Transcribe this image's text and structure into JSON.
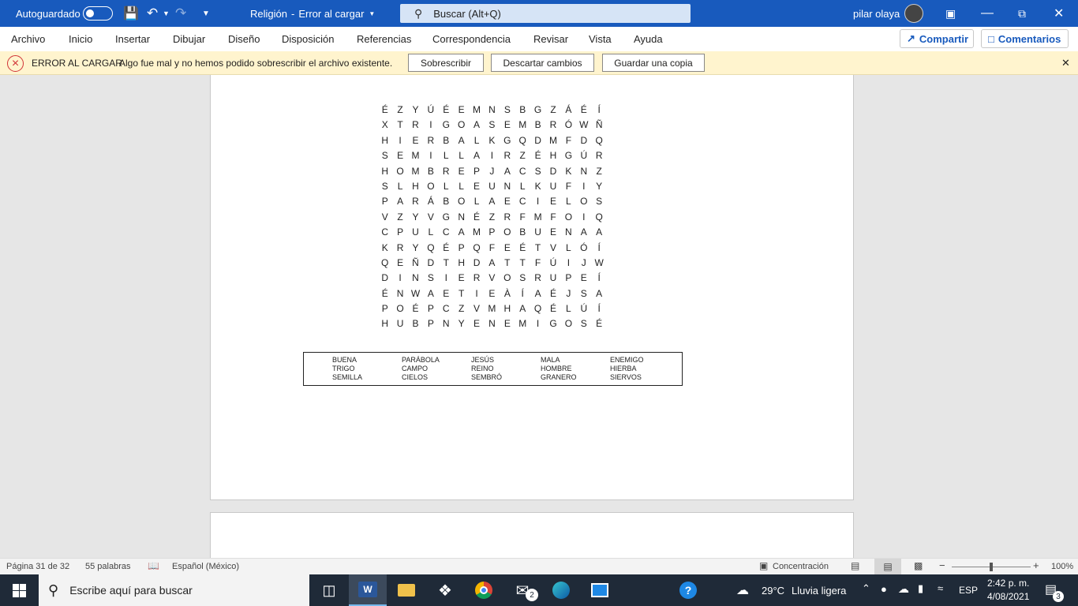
{
  "titlebar": {
    "autosave_label": "Autoguardado",
    "doc_title": "Religión",
    "separator": "-",
    "status": "Error al cargar",
    "search_label": "Buscar (Alt+Q)",
    "user_name": "pilar olaya"
  },
  "menu": {
    "items": [
      "Archivo",
      "Inicio",
      "Insertar",
      "Dibujar",
      "Diseño",
      "Disposición",
      "Referencias",
      "Correspondencia",
      "Revisar",
      "Vista",
      "Ayuda"
    ],
    "share_label": "Compartir",
    "comments_label": "Comentarios"
  },
  "error_bar": {
    "title": "ERROR AL CARGAR",
    "message": "Algo fue mal y no hemos podido sobrescribir el archivo existente.",
    "overwrite_label": "Sobrescribir",
    "discard_label": "Descartar cambios",
    "save_copy_label": "Guardar una copia",
    "close_glyph": "✕"
  },
  "puzzle": {
    "rows": [
      [
        "É",
        "Z",
        "Y",
        "Ú",
        "É",
        "E",
        "M",
        "N",
        "S",
        "B",
        "G",
        "Z",
        "Á",
        "É",
        "Í"
      ],
      [
        "X",
        "T",
        "R",
        "I",
        "G",
        "O",
        "A",
        "S",
        "E",
        "M",
        "B",
        "R",
        "Ó",
        "W",
        "Ñ"
      ],
      [
        "H",
        "I",
        "E",
        "R",
        "B",
        "A",
        "L",
        "K",
        "G",
        "Q",
        "D",
        "M",
        "F",
        "D",
        "Q"
      ],
      [
        "S",
        "E",
        "M",
        "I",
        "L",
        "L",
        "A",
        "I",
        "R",
        "Z",
        "É",
        "H",
        "G",
        "Ú",
        "R"
      ],
      [
        "H",
        "O",
        "M",
        "B",
        "R",
        "E",
        "P",
        "J",
        "A",
        "C",
        "S",
        "D",
        "K",
        "N",
        "Z"
      ],
      [
        "S",
        "L",
        "H",
        "O",
        "L",
        "L",
        "E",
        "U",
        "N",
        "L",
        "K",
        "U",
        "F",
        "I",
        "Y"
      ],
      [
        "P",
        "A",
        "R",
        "Á",
        "B",
        "O",
        "L",
        "A",
        "E",
        "C",
        "I",
        "E",
        "L",
        "O",
        "S"
      ],
      [
        "V",
        "Z",
        "Y",
        "V",
        "G",
        "N",
        "É",
        "Z",
        "R",
        "F",
        "M",
        "F",
        "O",
        "I",
        "Q"
      ],
      [
        "C",
        "P",
        "U",
        "L",
        "C",
        "A",
        "M",
        "P",
        "O",
        "B",
        "U",
        "E",
        "N",
        "A",
        "A"
      ],
      [
        "K",
        "R",
        "Y",
        "Q",
        "É",
        "P",
        "Q",
        "F",
        "E",
        "É",
        "T",
        "V",
        "L",
        "Ó",
        "Í"
      ],
      [
        "Q",
        "E",
        "Ñ",
        "D",
        "T",
        "H",
        "D",
        "A",
        "T",
        "T",
        "F",
        "Ú",
        "I",
        "J",
        "W"
      ],
      [
        "D",
        "I",
        "N",
        "S",
        "I",
        "E",
        "R",
        "V",
        "O",
        "S",
        "R",
        "U",
        "P",
        "E",
        "Í"
      ],
      [
        "É",
        "N",
        "W",
        "A",
        "E",
        "T",
        "I",
        "E",
        "À",
        "Í",
        "A",
        "É",
        "J",
        "S",
        "A"
      ],
      [
        "P",
        "O",
        "É",
        "P",
        "C",
        "Z",
        "V",
        "M",
        "H",
        "A",
        "Q",
        "É",
        "L",
        "Ú",
        "Í"
      ],
      [
        "H",
        "U",
        "B",
        "P",
        "N",
        "Y",
        "E",
        "N",
        "E",
        "M",
        "I",
        "G",
        "O",
        "S",
        "É"
      ]
    ],
    "word_columns": [
      [
        "BUENA",
        "TRIGO",
        "SEMILLA"
      ],
      [
        "PARÁBOLA",
        "CAMPO",
        "CIELOS"
      ],
      [
        "JESÚS",
        "REINO",
        "SEMBRÓ"
      ],
      [
        "MALA",
        "HOMBRE",
        "GRANERO"
      ],
      [
        "ENEMIGO",
        "HIERBA",
        "SIERVOS"
      ]
    ]
  },
  "statusbar": {
    "page": "Página 31 de 32",
    "words": "55 palabras",
    "language": "Español (México)",
    "focus": "Concentración",
    "zoom": "100%",
    "zoom_level": 1.0
  },
  "taskbar": {
    "search_placeholder": "Escribe aquí para buscar",
    "weather_temp": "29°C",
    "weather_desc": "Lluvia ligera",
    "lang": "ESP",
    "time": "2:42 p. m.",
    "date": "4/08/2021",
    "notifications": "3",
    "mail_badge": "2"
  },
  "colors": {
    "brand": "#185abd",
    "error_bg": "#fff4ce",
    "error_red": "#d13438",
    "taskbar": "#1f2a38"
  }
}
